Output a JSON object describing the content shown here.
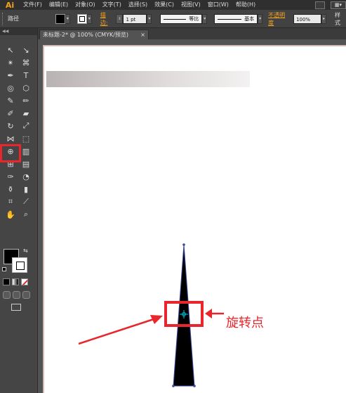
{
  "app": {
    "logo": "Ai"
  },
  "menu": {
    "items": [
      "文件(F)",
      "编辑(E)",
      "对象(O)",
      "文字(T)",
      "选择(S)",
      "效果(C)",
      "视图(V)",
      "窗口(W)",
      "帮助(H)"
    ],
    "right_icon": "▦▾"
  },
  "control_bar": {
    "selection_label": "路径",
    "stroke_label": "描边:",
    "stroke_weight": "1 pt",
    "profile_label": "等比",
    "brush_label": "基本",
    "opacity_label": "不透明度",
    "opacity_value": "100%",
    "style_label": "样式"
  },
  "document_tab": {
    "title": "未标题-2* @ 100% (CMYK/预览)",
    "close": "×"
  },
  "toolbox": {
    "header": "◀◀",
    "tools": [
      {
        "name": "selection-tool",
        "glyph": "↖"
      },
      {
        "name": "direct-selection-tool",
        "glyph": "↘"
      },
      {
        "name": "magic-wand-tool",
        "glyph": "✴"
      },
      {
        "name": "lasso-tool",
        "glyph": "⌘"
      },
      {
        "name": "pen-tool",
        "glyph": "✒"
      },
      {
        "name": "type-tool",
        "glyph": "T"
      },
      {
        "name": "spiral-tool",
        "glyph": "◎"
      },
      {
        "name": "rectangle-tool",
        "glyph": "⬡"
      },
      {
        "name": "paintbrush-tool",
        "glyph": "✎"
      },
      {
        "name": "pencil-tool",
        "glyph": "✏"
      },
      {
        "name": "blob-brush-tool",
        "glyph": "✐"
      },
      {
        "name": "eraser-tool",
        "glyph": "▰"
      },
      {
        "name": "rotate-tool",
        "glyph": "↻"
      },
      {
        "name": "scale-tool",
        "glyph": "⤢"
      },
      {
        "name": "width-tool",
        "glyph": "⋈"
      },
      {
        "name": "free-transform-tool",
        "glyph": "⬚"
      },
      {
        "name": "shape-builder-tool",
        "glyph": "⊕"
      },
      {
        "name": "perspective-grid-tool",
        "glyph": "▥"
      },
      {
        "name": "mesh-tool",
        "glyph": "⊞"
      },
      {
        "name": "gradient-tool",
        "glyph": "▤"
      },
      {
        "name": "eyedropper-tool",
        "glyph": "✑"
      },
      {
        "name": "blend-tool",
        "glyph": "◔"
      },
      {
        "name": "symbol-sprayer-tool",
        "glyph": "⚱"
      },
      {
        "name": "column-graph-tool",
        "glyph": "▮"
      },
      {
        "name": "artboard-tool",
        "glyph": "⌗"
      },
      {
        "name": "slice-tool",
        "glyph": "⟋"
      },
      {
        "name": "hand-tool",
        "glyph": "✋"
      },
      {
        "name": "zoom-tool",
        "glyph": "⌕"
      }
    ],
    "swap_glyph": "⇆"
  },
  "annotation": {
    "pivot_label": "旋转点"
  },
  "colors": {
    "highlight": "#e8262b",
    "accent": "#f7a21b",
    "pivot": "#00c8e0"
  }
}
